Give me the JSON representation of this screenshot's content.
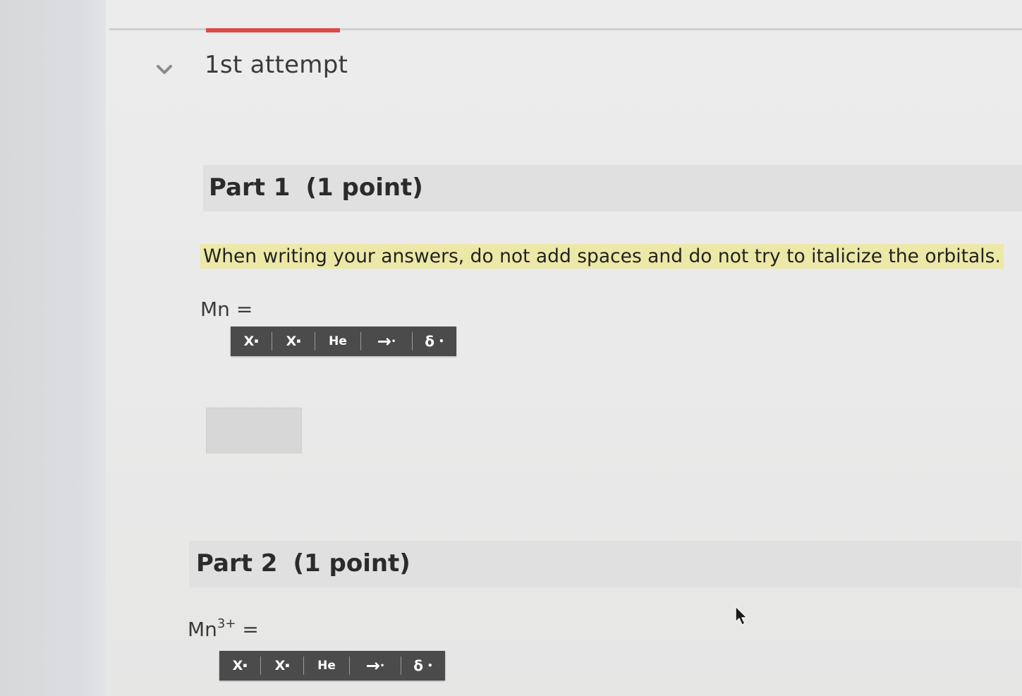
{
  "attempt": {
    "title": "1st attempt"
  },
  "instructions": "When writing your answers, do not add spaces and do not try to italicize the orbitals.",
  "parts": [
    {
      "label": "Part 1",
      "points": "(1 point)",
      "formula_base": "Mn",
      "formula_charge": "",
      "formula_equals": "="
    },
    {
      "label": "Part 2",
      "points": "(1 point)",
      "formula_base": "Mn",
      "formula_charge": "3+",
      "formula_equals": "="
    }
  ],
  "toolbar": {
    "superscript_label": "X",
    "subscript_label": "X",
    "element_label": "He",
    "arrow_label": "→",
    "delta_label": "δ"
  },
  "colors": {
    "accent_tab": "#dd4a48",
    "highlight": "#ece9a8",
    "toolbar_bg": "#4b4b4b"
  },
  "icons": {
    "collapse": "chevron-down-icon",
    "pointer": "mouse-pointer-icon"
  }
}
